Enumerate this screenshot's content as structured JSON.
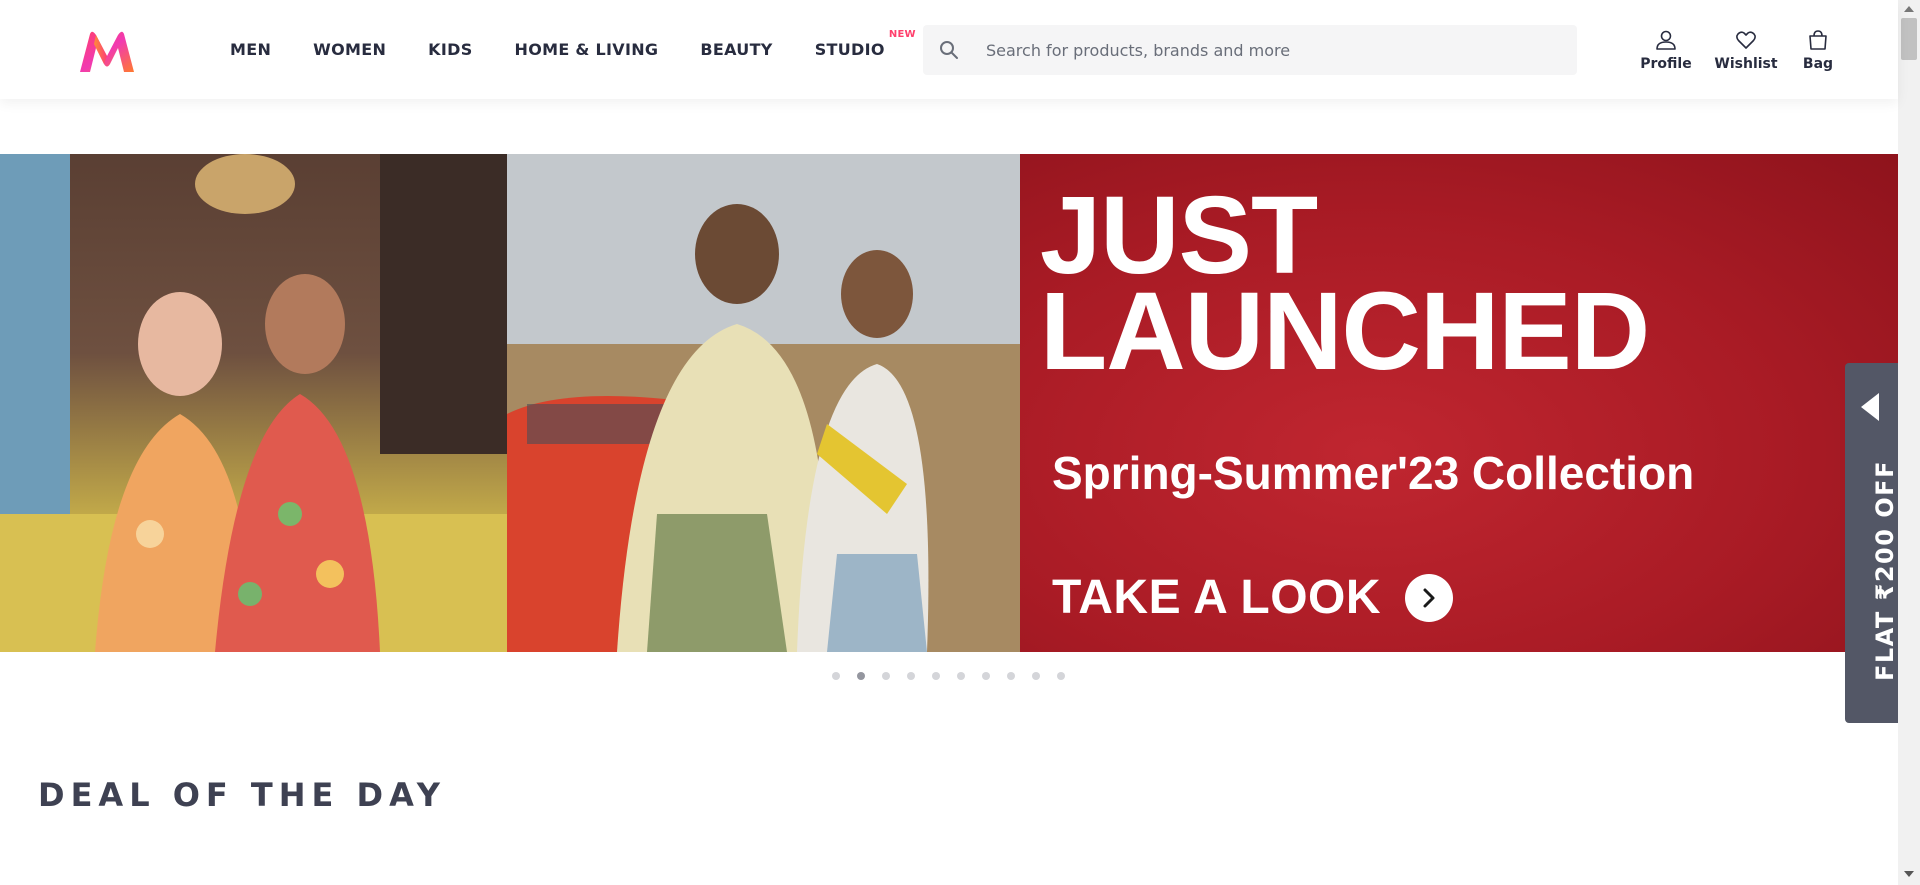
{
  "header": {
    "logo_name": "myntra-logo",
    "nav": [
      {
        "label": "MEN",
        "badge": ""
      },
      {
        "label": "WOMEN",
        "badge": ""
      },
      {
        "label": "KIDS",
        "badge": ""
      },
      {
        "label": "HOME & LIVING",
        "badge": ""
      },
      {
        "label": "BEAUTY",
        "badge": ""
      },
      {
        "label": "STUDIO",
        "badge": "NEW"
      }
    ],
    "search": {
      "placeholder": "Search for products, brands and more",
      "value": ""
    },
    "actions": [
      {
        "label": "Profile",
        "icon": "profile-icon"
      },
      {
        "label": "Wishlist",
        "icon": "heart-icon"
      },
      {
        "label": "Bag",
        "icon": "bag-icon"
      }
    ]
  },
  "banner": {
    "headline_line1": "JUST",
    "headline_line2": "LAUNCHED",
    "subheading": "Spring-Summer'23 Collection",
    "cta": "TAKE A LOOK",
    "slide_count": 10,
    "active_slide": 2
  },
  "offer_tab": {
    "label": "FLAT ₹200 OFF"
  },
  "section": {
    "title": "DEAL OF THE DAY"
  },
  "colors": {
    "brand": "#ff3f6c",
    "banner_red": "#a91b25",
    "offer_bg": "#535766",
    "text": "#282c3f"
  }
}
